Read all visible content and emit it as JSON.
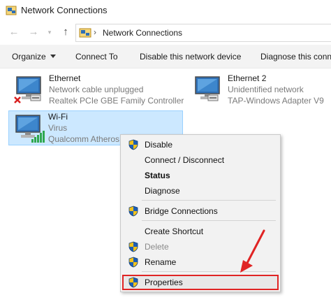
{
  "window": {
    "title": "Network Connections"
  },
  "address": {
    "crumb": "Network Connections"
  },
  "commands": {
    "organize": "Organize",
    "connect_to": "Connect To",
    "disable_device": "Disable this network device",
    "diagnose": "Diagnose this conn"
  },
  "items": [
    {
      "name": "Ethernet",
      "status": "Network cable unplugged",
      "adapter": "Realtek PCIe GBE Family Controller"
    },
    {
      "name": "Ethernet 2",
      "status": "Unidentified network",
      "adapter": "TAP-Windows Adapter V9"
    },
    {
      "name": "Wi-Fi",
      "status": "Virus",
      "adapter": "Qualcomm Atheros"
    }
  ],
  "menu": {
    "disable": "Disable",
    "connect_disconnect": "Connect / Disconnect",
    "status": "Status",
    "diagnose": "Diagnose",
    "bridge": "Bridge Connections",
    "create_shortcut": "Create Shortcut",
    "delete": "Delete",
    "rename": "Rename",
    "properties": "Properties"
  },
  "colors": {
    "selection_bg": "#cce8ff",
    "highlight_outline": "#e02424",
    "shield_blue": "#1e5fb4",
    "shield_yellow": "#f2c21b"
  }
}
